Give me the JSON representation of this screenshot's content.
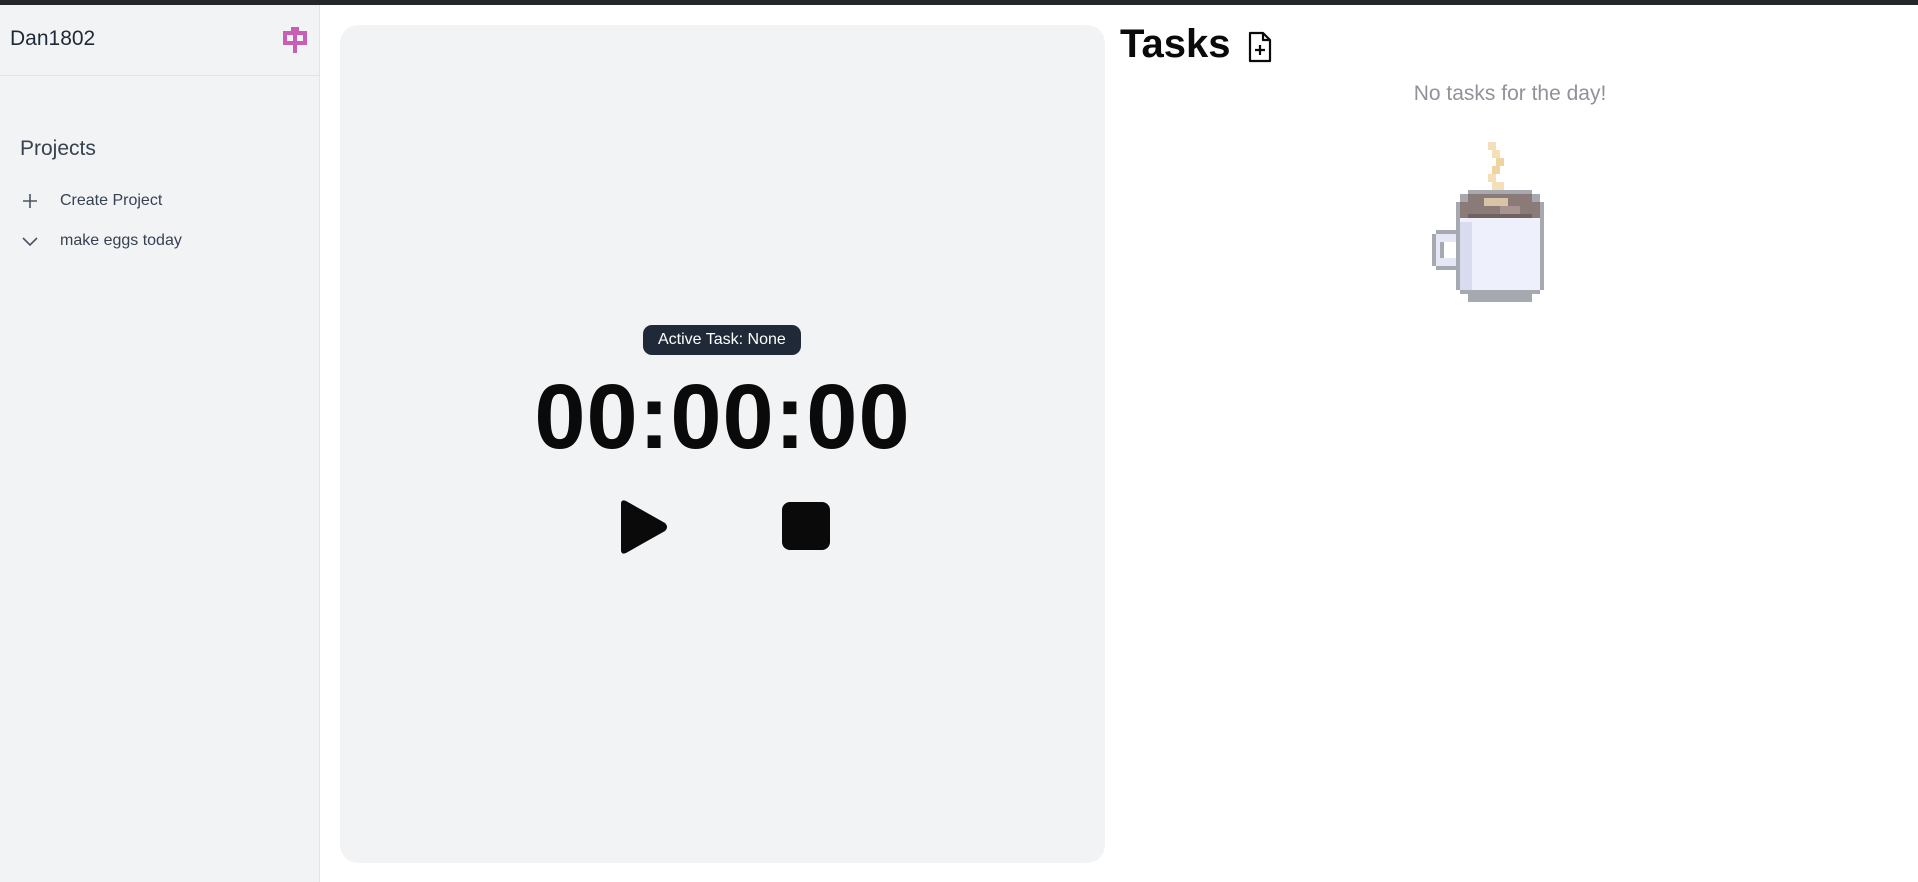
{
  "sidebar": {
    "username": "Dan1802",
    "logo_icon": "pixel-logo-icon",
    "projects_title": "Projects",
    "items": [
      {
        "icon": "plus-icon",
        "label": "Create Project"
      },
      {
        "icon": "chevron-down-icon",
        "label": "make eggs today"
      }
    ]
  },
  "timer": {
    "active_task_label": "Active Task: None",
    "time": "00:00:00",
    "play_icon": "play-icon",
    "stop_icon": "stop-icon"
  },
  "tasks": {
    "title": "Tasks",
    "add_icon": "add-file-icon",
    "empty_message": "No tasks for the day!",
    "illustration": "coffee-cup-icon"
  },
  "colors": {
    "sidebar_bg": "#f2f3f5",
    "badge_bg": "#1f2937",
    "logo": "#c95fb4",
    "muted_text": "#8f9399"
  }
}
